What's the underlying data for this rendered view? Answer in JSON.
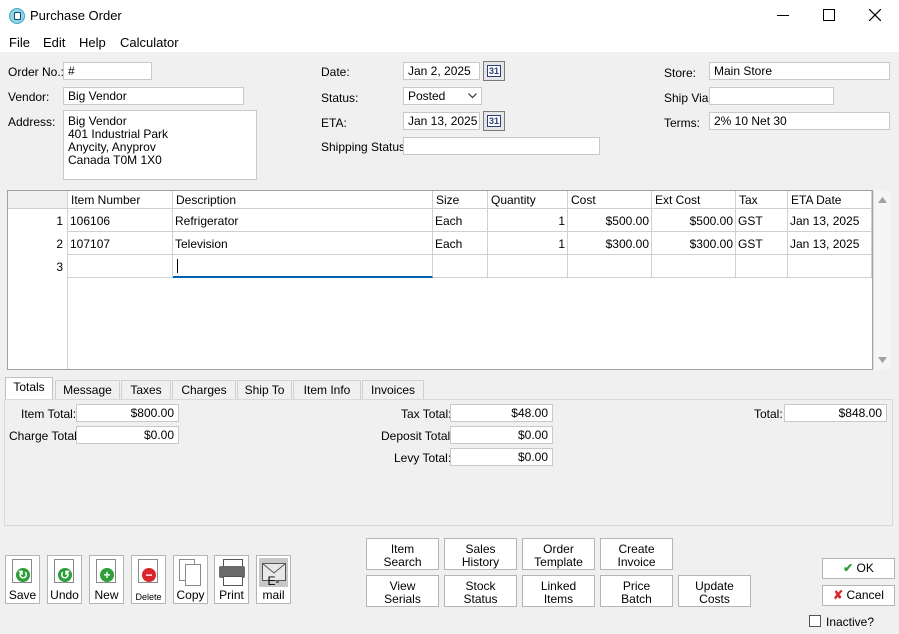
{
  "window": {
    "title": "Purchase Order",
    "minimize_glyph": "—",
    "maximize_glyph": "☐",
    "close_glyph": "✕"
  },
  "menu": [
    "File",
    "Edit",
    "Help",
    "Calculator"
  ],
  "header": {
    "order_no_label": "Order No.:",
    "order_no_value": "#",
    "vendor_label": "Vendor:",
    "vendor_value": "Big Vendor",
    "address_label": "Address:",
    "address_lines": [
      "Big Vendor",
      "401 Industrial Park",
      "Anycity, Anyprov",
      "Canada  T0M 1X0"
    ],
    "date_label": "Date:",
    "date_value": "Jan 2, 2025",
    "status_label": "Status:",
    "status_value": "Posted",
    "eta_label": "ETA:",
    "eta_value": "Jan 13, 2025",
    "shipping_status_label": "Shipping Status:",
    "shipping_status_value": "",
    "store_label": "Store:",
    "store_value": "Main Store",
    "ship_via_label": "Ship Via:",
    "ship_via_value": "",
    "terms_label": "Terms:",
    "terms_value": "2% 10 Net 30",
    "calendar_glyph": "31"
  },
  "grid": {
    "columns": [
      "Item Number",
      "Description",
      "Size",
      "Quantity",
      "Cost",
      "Ext Cost",
      "Tax",
      "ETA Date"
    ],
    "rows": [
      {
        "n": "1",
        "item": "106106",
        "desc": "Refrigerator",
        "size": "Each",
        "qty": "1",
        "cost": "$500.00",
        "ext": "$500.00",
        "tax": "GST",
        "eta": "Jan 13, 2025"
      },
      {
        "n": "2",
        "item": "107107",
        "desc": "Television",
        "size": "Each",
        "qty": "1",
        "cost": "$300.00",
        "ext": "$300.00",
        "tax": "GST",
        "eta": "Jan 13, 2025"
      },
      {
        "n": "3",
        "item": "",
        "desc": "",
        "size": "",
        "qty": "",
        "cost": "",
        "ext": "",
        "tax": "",
        "eta": ""
      }
    ]
  },
  "tabs": [
    "Totals",
    "Message",
    "Taxes",
    "Charges",
    "Ship To",
    "Item Info",
    "Invoices"
  ],
  "totals": {
    "item_total_label": "Item Total:",
    "item_total": "$800.00",
    "charge_total_label": "Charge Total:",
    "charge_total": "$0.00",
    "tax_total_label": "Tax Total:",
    "tax_total": "$48.00",
    "deposit_total_label": "Deposit Total:",
    "deposit_total": "$0.00",
    "levy_total_label": "Levy Total:",
    "levy_total": "$0.00",
    "total_label": "Total:",
    "total": "$848.00"
  },
  "toolbar": [
    "Save",
    "Undo",
    "New",
    "Delete",
    "Copy",
    "Print",
    "E-mail"
  ],
  "actions": [
    [
      "Item",
      "Search"
    ],
    [
      "Sales",
      "History"
    ],
    [
      "Order",
      "Template"
    ],
    [
      "Create",
      "Invoice"
    ],
    [
      "View",
      "Serials"
    ],
    [
      "Stock",
      "Status"
    ],
    [
      "Linked",
      "Items"
    ],
    [
      "Price",
      "Batch"
    ],
    [
      "Update",
      "Costs"
    ]
  ],
  "dialog": {
    "ok": "OK",
    "cancel": "Cancel",
    "inactive": "Inactive?"
  },
  "colors": {
    "accent": "#0063b1",
    "save_green": "#2e9e3a",
    "delete_red": "#d9262c"
  }
}
